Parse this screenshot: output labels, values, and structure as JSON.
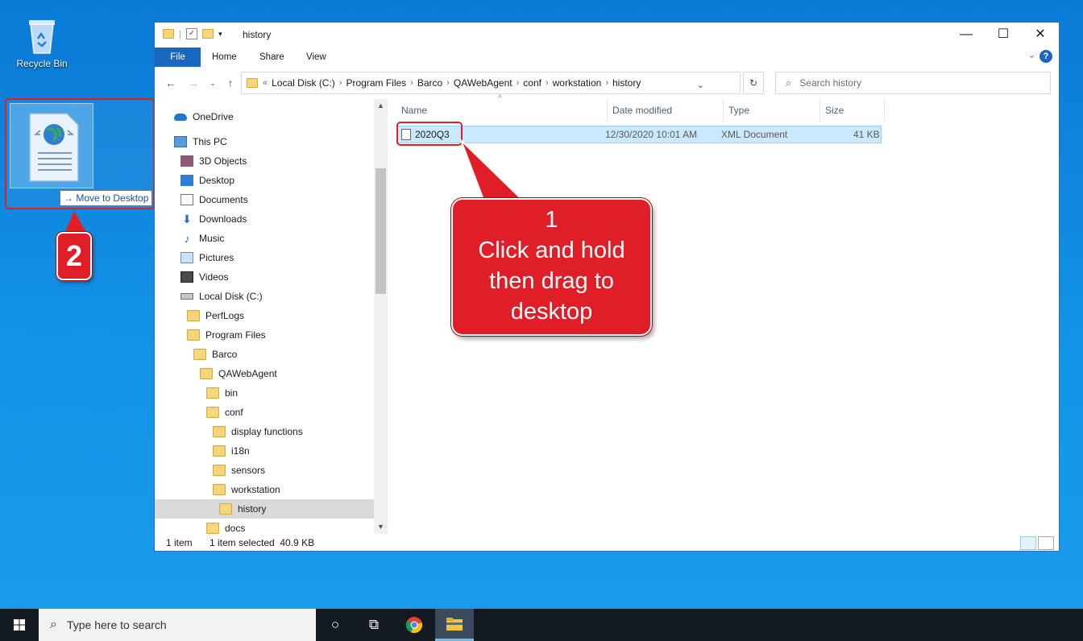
{
  "desktop": {
    "recycle_bin_label": "Recycle Bin",
    "drag_tooltip": "Move to Desktop",
    "step2_badge": "2"
  },
  "window": {
    "title": "history",
    "controls": {
      "minimize": "—",
      "maximize": "☐",
      "close": "✕"
    },
    "ribbon_tabs": [
      "File",
      "Home",
      "Share",
      "View"
    ],
    "help": "?"
  },
  "address": {
    "overflow": "«",
    "crumbs": [
      "Local Disk (C:)",
      "Program Files",
      "Barco",
      "QAWebAgent",
      "conf",
      "workstation",
      "history"
    ],
    "separator": "›"
  },
  "search": {
    "placeholder": "Search history"
  },
  "nav_tree": [
    {
      "label": "OneDrive",
      "icon": "onedrive-icon"
    },
    {
      "label": "This PC",
      "icon": "this-pc-icon"
    },
    {
      "label": "3D Objects",
      "icon": "3d-objects-icon"
    },
    {
      "label": "Desktop",
      "icon": "desktop-icon"
    },
    {
      "label": "Documents",
      "icon": "documents-icon"
    },
    {
      "label": "Downloads",
      "icon": "downloads-icon"
    },
    {
      "label": "Music",
      "icon": "music-icon"
    },
    {
      "label": "Pictures",
      "icon": "pictures-icon"
    },
    {
      "label": "Videos",
      "icon": "videos-icon"
    },
    {
      "label": "Local Disk (C:)",
      "icon": "local-disk-icon"
    },
    {
      "label": "PerfLogs",
      "icon": "folder-icon"
    },
    {
      "label": "Program Files",
      "icon": "folder-icon"
    },
    {
      "label": "Barco",
      "icon": "folder-icon"
    },
    {
      "label": "QAWebAgent",
      "icon": "folder-icon"
    },
    {
      "label": "bin",
      "icon": "folder-icon"
    },
    {
      "label": "conf",
      "icon": "folder-icon"
    },
    {
      "label": "display functions",
      "icon": "folder-icon"
    },
    {
      "label": "i18n",
      "icon": "folder-icon"
    },
    {
      "label": "sensors",
      "icon": "folder-icon"
    },
    {
      "label": "workstation",
      "icon": "folder-icon"
    },
    {
      "label": "history",
      "icon": "folder-icon",
      "selected": true
    },
    {
      "label": "docs",
      "icon": "folder-icon"
    }
  ],
  "columns": [
    "Name",
    "Date modified",
    "Type",
    "Size"
  ],
  "files": [
    {
      "name": "2020Q3",
      "date": "12/30/2020 10:01 AM",
      "type": "XML Document",
      "size": "41 KB"
    }
  ],
  "status": {
    "count": "1 item",
    "selection": "1 item selected  40.9 KB"
  },
  "callout": {
    "step": "1",
    "lines": [
      "Click and hold",
      "then drag to",
      "desktop"
    ]
  },
  "taskbar": {
    "search_placeholder": "Type here to search"
  },
  "colors": {
    "accent": "#1a67c0",
    "annotation_red": "#e01e27",
    "selection": "#cce8ff",
    "desktop": "#0a7ad6"
  }
}
